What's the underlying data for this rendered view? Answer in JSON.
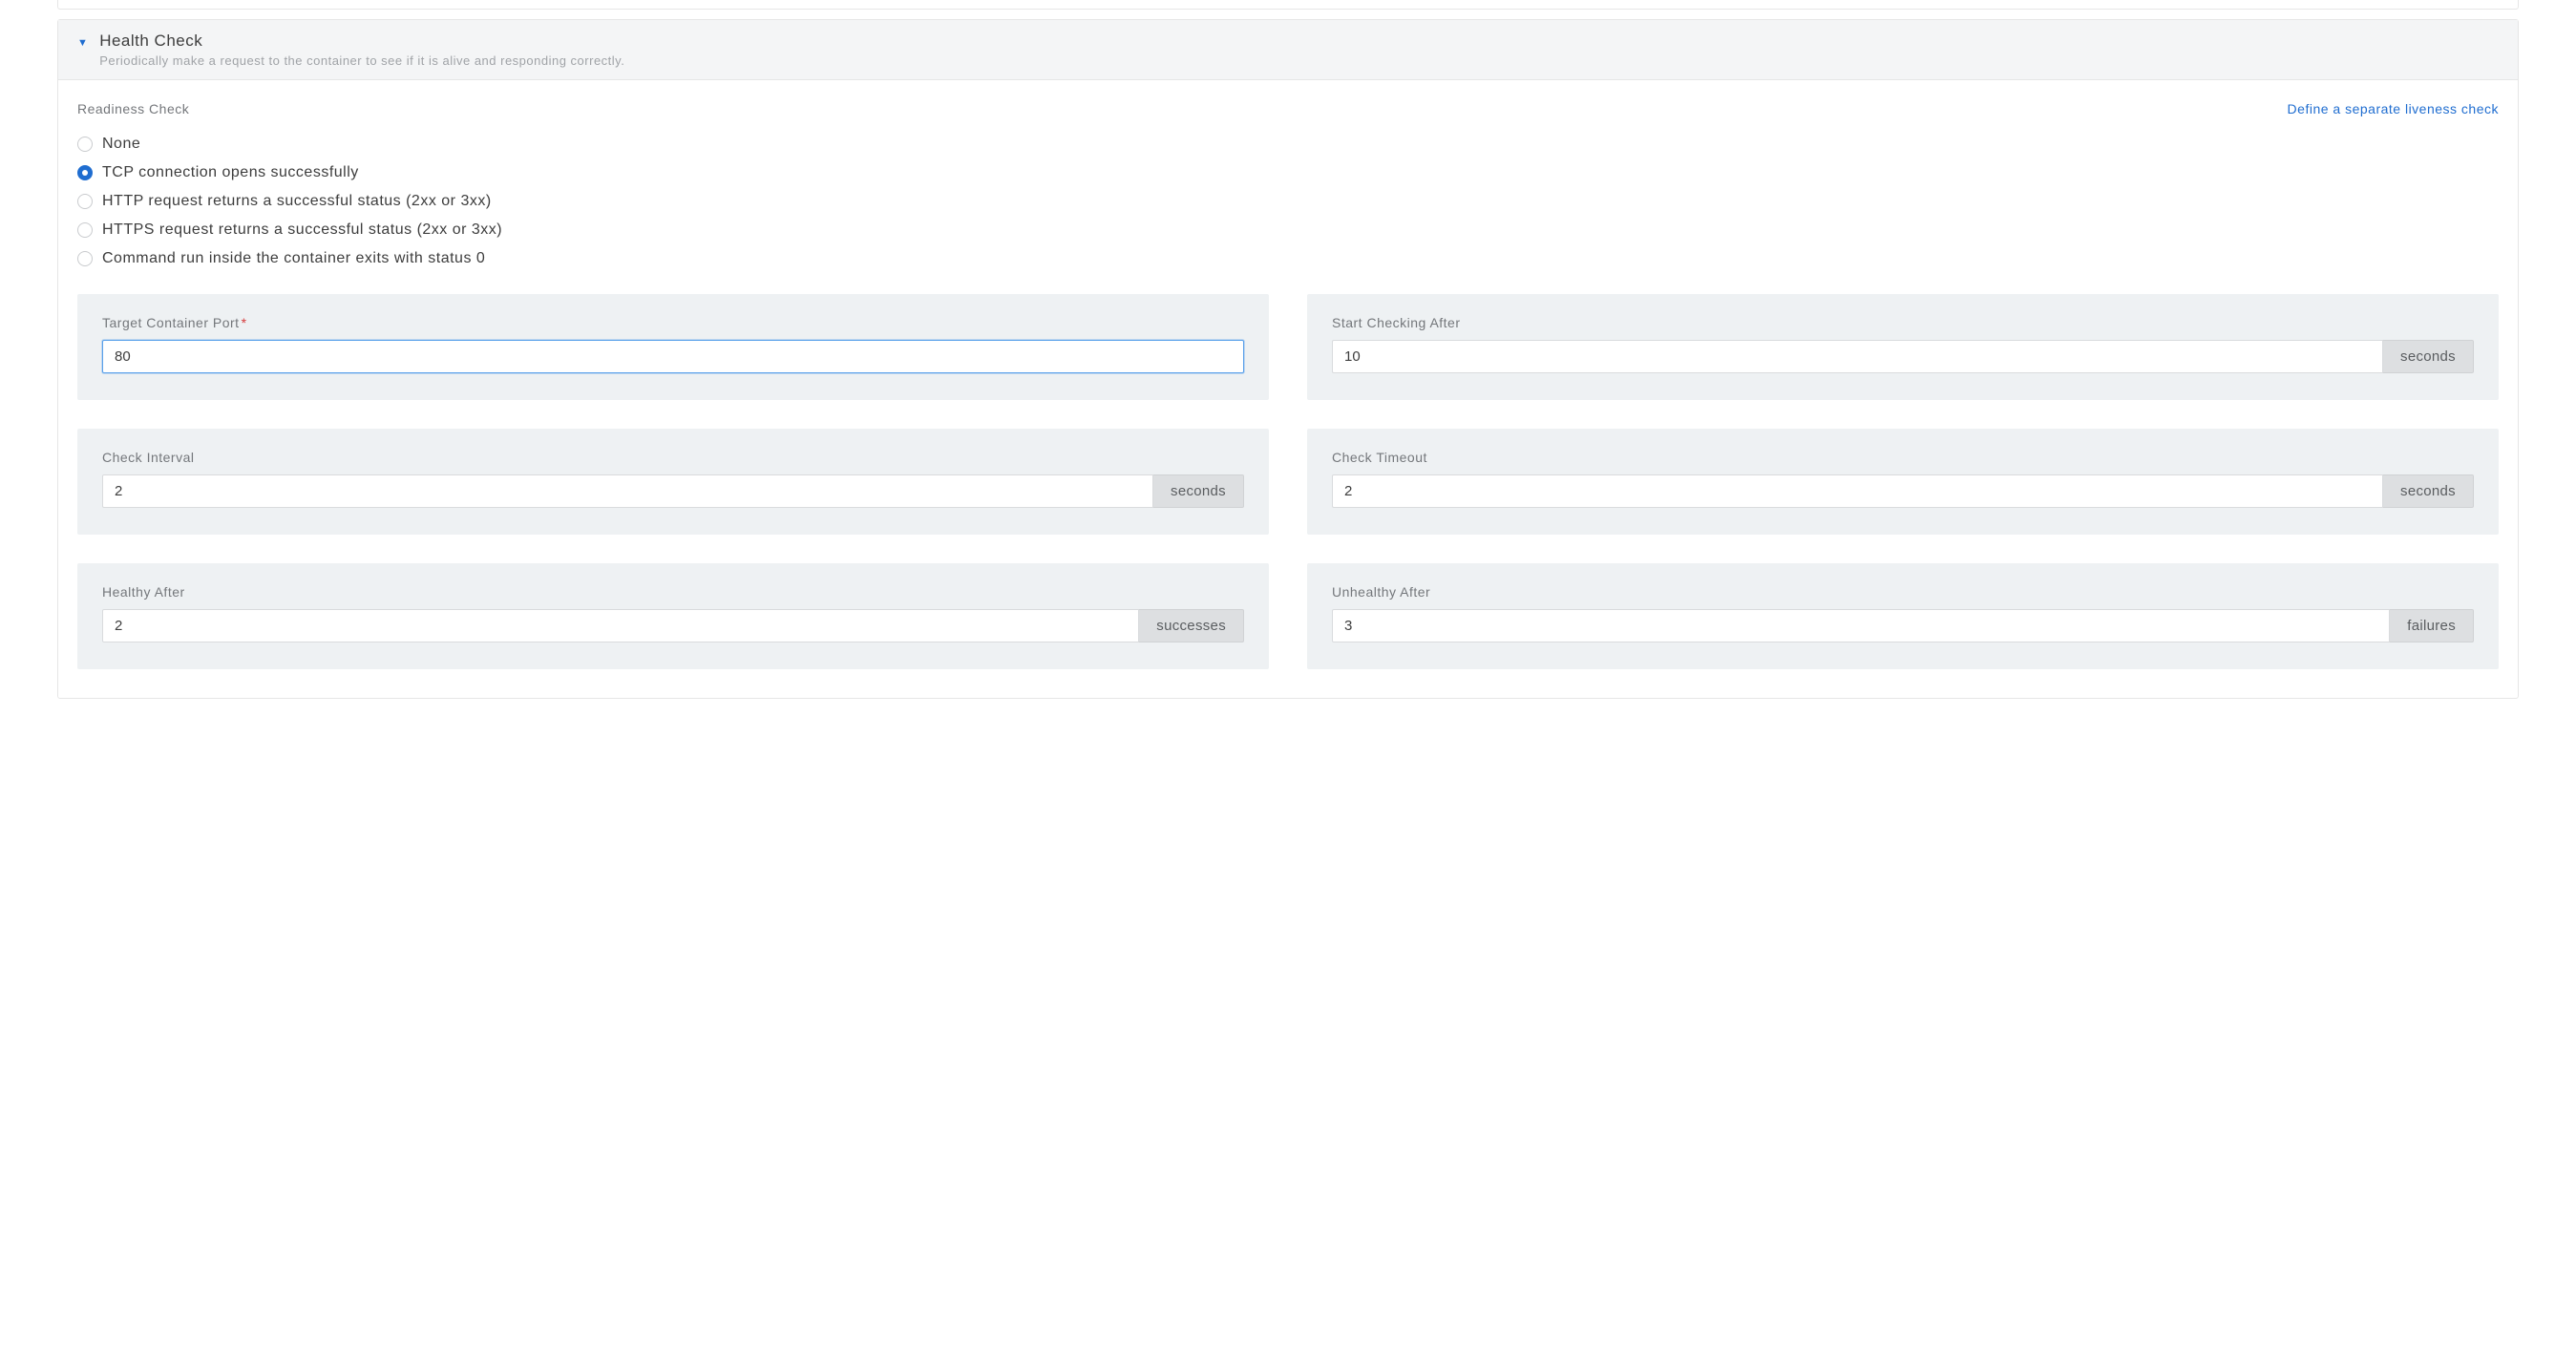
{
  "panel": {
    "title": "Health Check",
    "subtitle": "Periodically make a request to the container to see if it is alive and responding correctly."
  },
  "section": {
    "label": "Readiness Check",
    "link": "Define a separate liveness check"
  },
  "radios": {
    "none": "None",
    "tcp": "TCP connection opens successfully",
    "http": "HTTP request returns a successful status (2xx or 3xx)",
    "https": "HTTPS request returns a successful status (2xx or 3xx)",
    "cmd": "Command run inside the container exits with status 0"
  },
  "fields": {
    "port": {
      "label": "Target Container Port",
      "value": "80"
    },
    "start": {
      "label": "Start Checking After",
      "value": "10",
      "addon": "seconds"
    },
    "interval": {
      "label": "Check Interval",
      "value": "2",
      "addon": "seconds"
    },
    "timeout": {
      "label": "Check Timeout",
      "value": "2",
      "addon": "seconds"
    },
    "healthy": {
      "label": "Healthy After",
      "value": "2",
      "addon": "successes"
    },
    "unhealthy": {
      "label": "Unhealthy After",
      "value": "3",
      "addon": "failures"
    }
  }
}
